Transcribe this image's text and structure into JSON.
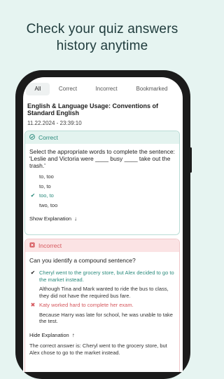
{
  "headline": {
    "line1": "Check your quiz answers",
    "line2": "history anytime"
  },
  "tabs": [
    {
      "label": "All",
      "active": true
    },
    {
      "label": "Correct",
      "active": false
    },
    {
      "label": "Incorrect",
      "active": false
    },
    {
      "label": "Bookmarked",
      "active": false
    }
  ],
  "quiz": {
    "title": "English & Language Usage: Conventions of Standard English",
    "date": "11.22.2024 - 23:39:10"
  },
  "correct_card": {
    "status": "Correct",
    "status_icon": "check-circle-icon",
    "question": "Select the appropriate words to complete the sentence: 'Leslie and Victoria were ____ busy ____ take out the trash.'",
    "answers": [
      {
        "text": "to, too",
        "state": "none"
      },
      {
        "text": "to, to",
        "state": "none"
      },
      {
        "text": "too, to",
        "state": "selected-correct"
      },
      {
        "text": "two, too",
        "state": "none"
      }
    ],
    "explanation_link": "Show Explanation",
    "accent": "#2a8a7c"
  },
  "incorrect_card": {
    "status": "Incorrect",
    "status_icon": "x-square-icon",
    "question": "Can you identify a compound sentence?",
    "answers": [
      {
        "text": "Cheryl went to the grocery store, but Alex decided to go to the market instead.",
        "state": "correct-answer"
      },
      {
        "text": "Although Tina and Mark wanted to ride the bus to class, they did not have the required bus fare.",
        "state": "none"
      },
      {
        "text": "Katy worked hard to complete her exam.",
        "state": "selected-wrong"
      },
      {
        "text": "Because Harry was late for school, he was unable to take the test.",
        "state": "none"
      }
    ],
    "explanation_link": "Hide Explanation",
    "explanation": "The correct answer is: Cheryl went to the grocery store, but Alex chose to go to the market instead.",
    "accent": "#d5565c"
  }
}
